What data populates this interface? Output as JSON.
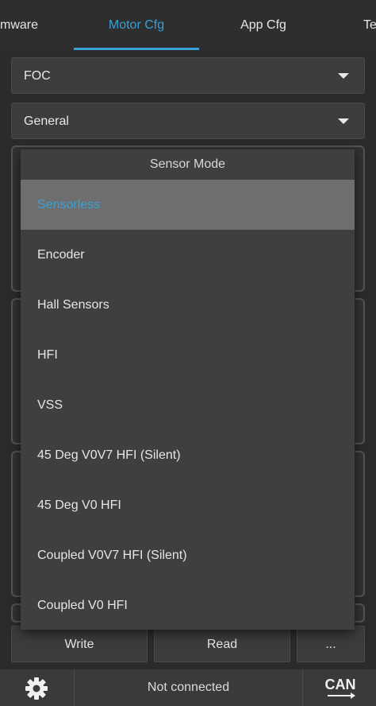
{
  "tabs": [
    {
      "label": "mware",
      "active": false
    },
    {
      "label": "Motor Cfg",
      "active": true
    },
    {
      "label": "App Cfg",
      "active": false
    },
    {
      "label": "Te",
      "active": false
    }
  ],
  "motor_type_select": {
    "value": "FOC"
  },
  "section_select": {
    "value": "General"
  },
  "sensor_mode_popup": {
    "title": "Sensor Mode",
    "options": [
      {
        "label": "Sensorless",
        "selected": true
      },
      {
        "label": "Encoder",
        "selected": false
      },
      {
        "label": "Hall Sensors",
        "selected": false
      },
      {
        "label": "HFI",
        "selected": false
      },
      {
        "label": "VSS",
        "selected": false
      },
      {
        "label": "45 Deg V0V7 HFI (Silent)",
        "selected": false
      },
      {
        "label": "45 Deg V0 HFI",
        "selected": false
      },
      {
        "label": "Coupled V0V7 HFI (Silent)",
        "selected": false
      },
      {
        "label": "Coupled V0 HFI",
        "selected": false
      }
    ]
  },
  "actions": {
    "write_label": "Write",
    "read_label": "Read",
    "more_label": "..."
  },
  "status": {
    "text": "Not connected",
    "settings_icon": "gear-icon",
    "can_icon": "can-icon",
    "can_label": "CAN"
  },
  "colors": {
    "accent": "#3aa0d8",
    "background": "#2b2b2b",
    "popup": "#3f3f3f",
    "selected_row": "#6e6e6e"
  }
}
